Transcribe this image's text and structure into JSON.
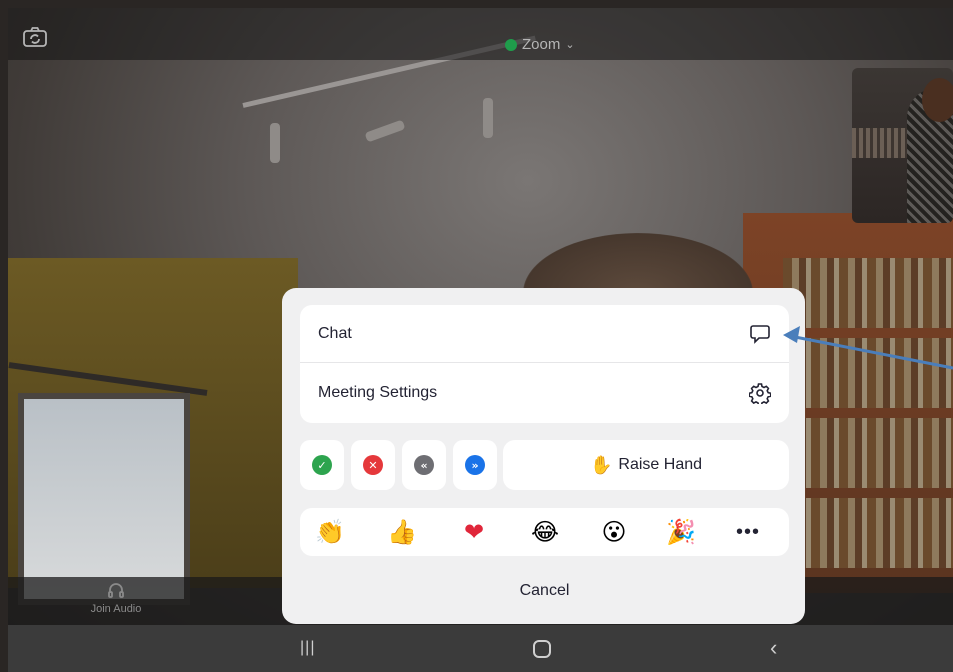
{
  "app": {
    "title": "Zoom"
  },
  "bottom_bar": {
    "join_audio_label": "Join Audio"
  },
  "menu": {
    "items": [
      {
        "label": "Chat",
        "icon": "chat-bubble-icon"
      },
      {
        "label": "Meeting Settings",
        "icon": "gear-icon"
      }
    ]
  },
  "nonverbal": [
    {
      "name": "yes",
      "symbol": "✓",
      "color": "#2da44e"
    },
    {
      "name": "no",
      "symbol": "✕",
      "color": "#e5383b"
    },
    {
      "name": "slow-down",
      "symbol": "«",
      "color": "#6e6e73"
    },
    {
      "name": "speed-up",
      "symbol": "»",
      "color": "#1a73e8"
    }
  ],
  "raise_hand": {
    "label": "Raise Hand",
    "icon": "✋"
  },
  "emojis": [
    {
      "name": "clap",
      "char": "👏"
    },
    {
      "name": "thumbs-up",
      "char": "👍"
    },
    {
      "name": "heart",
      "char": "❤"
    },
    {
      "name": "tears-of-joy",
      "char": "😂"
    },
    {
      "name": "open-mouth",
      "char": "😮"
    },
    {
      "name": "tada",
      "char": "🎉"
    }
  ],
  "more_label": "•••",
  "cancel_label": "Cancel",
  "colors": {
    "sheet_bg": "#f0f0f1",
    "card_bg": "#ffffff",
    "annotation_arrow": "#4a7ebb",
    "zoom_secure": "#1f9d4b"
  }
}
